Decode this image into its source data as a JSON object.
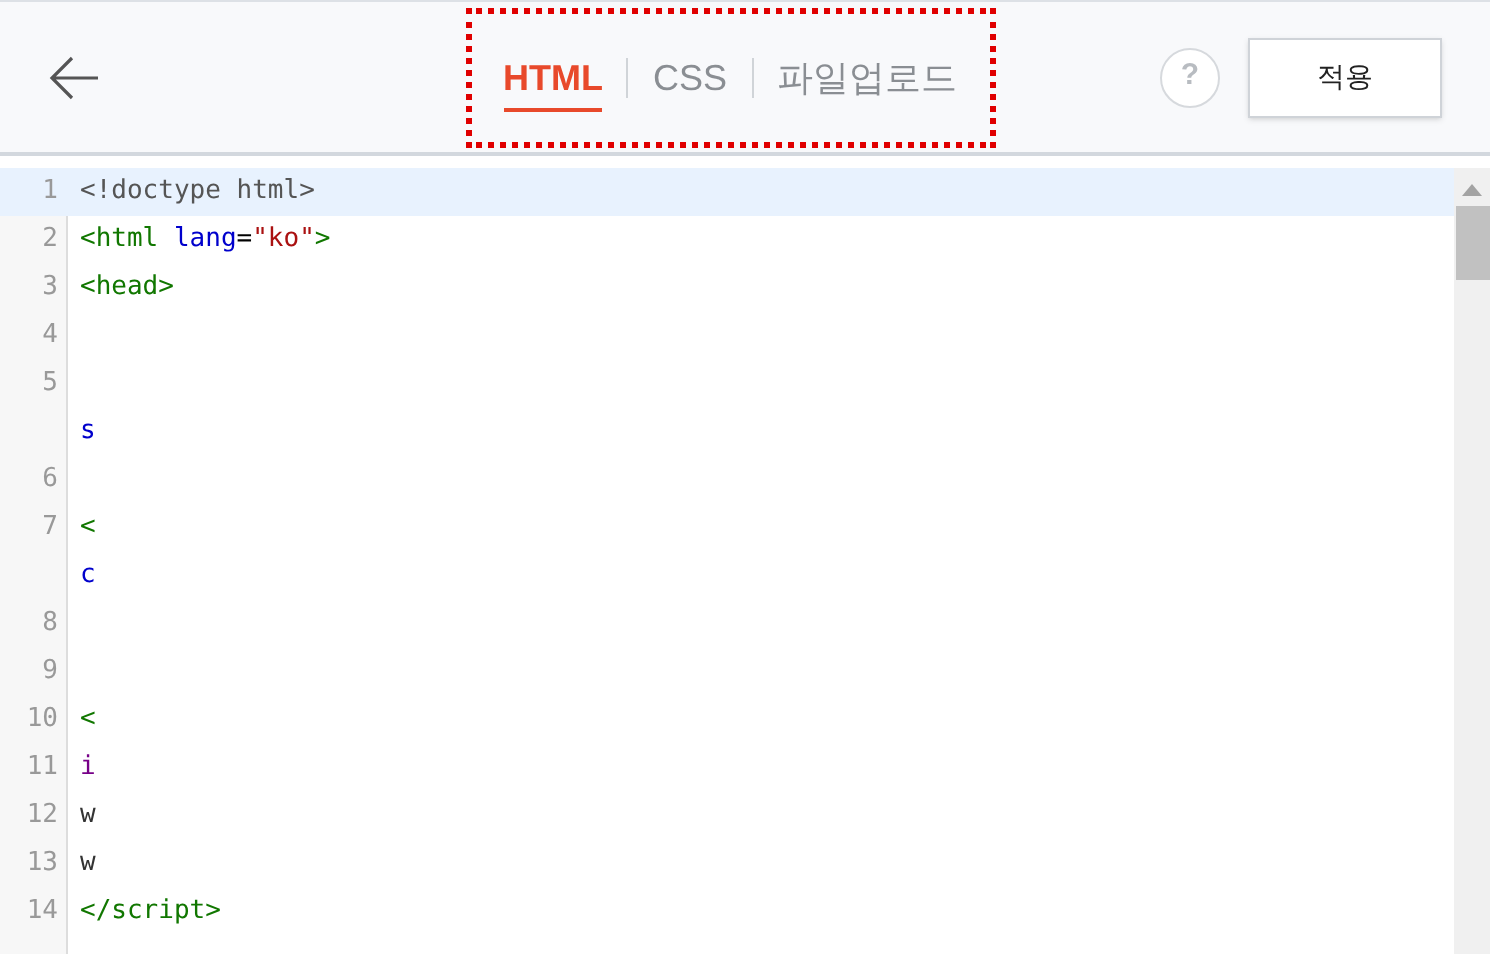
{
  "header": {
    "tabs": [
      {
        "label": "HTML",
        "selected": true
      },
      {
        "label": "CSS",
        "selected": false
      },
      {
        "label": "파일업로드",
        "selected": false
      }
    ],
    "help": "?",
    "apply_button": "적용"
  },
  "editor": {
    "lines": [
      {
        "number": "1",
        "active": true,
        "tokens": [
          {
            "text": "<!doctype html>",
            "kind": "meta"
          }
        ]
      },
      {
        "number": "2",
        "active": false,
        "tokens": [
          {
            "text": "<html",
            "kind": "tag"
          },
          {
            "text": " lang",
            "kind": "attr"
          },
          {
            "text": "=",
            "kind": "plain"
          },
          {
            "text": "\"ko\"",
            "kind": "string"
          },
          {
            "text": ">",
            "kind": "tag"
          }
        ]
      },
      {
        "number": "3",
        "active": false,
        "tokens": [
          {
            "text": "<head>",
            "kind": "tag"
          }
        ]
      },
      {
        "number": "4",
        "active": false
      },
      {
        "number": "5",
        "active": false,
        "wrap": [
          {
            "text": "s",
            "kind": "attr"
          }
        ]
      },
      {
        "number": "6",
        "active": false
      },
      {
        "number": "7",
        "active": false,
        "tokens": [
          {
            "text": "<",
            "kind": "tag"
          }
        ],
        "wrap": [
          {
            "text": "c",
            "kind": "attr"
          }
        ]
      },
      {
        "number": "8",
        "active": false
      },
      {
        "number": "9",
        "active": false
      },
      {
        "number": "10",
        "active": false,
        "tokens": [
          {
            "text": "<",
            "kind": "tag"
          }
        ]
      },
      {
        "number": "11",
        "active": false,
        "tokens": [
          {
            "text": "i",
            "kind": "keyword"
          }
        ]
      },
      {
        "number": "12",
        "active": false,
        "tokens": [
          {
            "text": "w",
            "kind": "variable"
          }
        ]
      },
      {
        "number": "13",
        "active": false,
        "tokens": [
          {
            "text": "w",
            "kind": "variable"
          }
        ]
      },
      {
        "number": "14",
        "active": false,
        "tokens": [
          {
            "text": "</script>",
            "kind": "tag"
          }
        ]
      }
    ]
  }
}
